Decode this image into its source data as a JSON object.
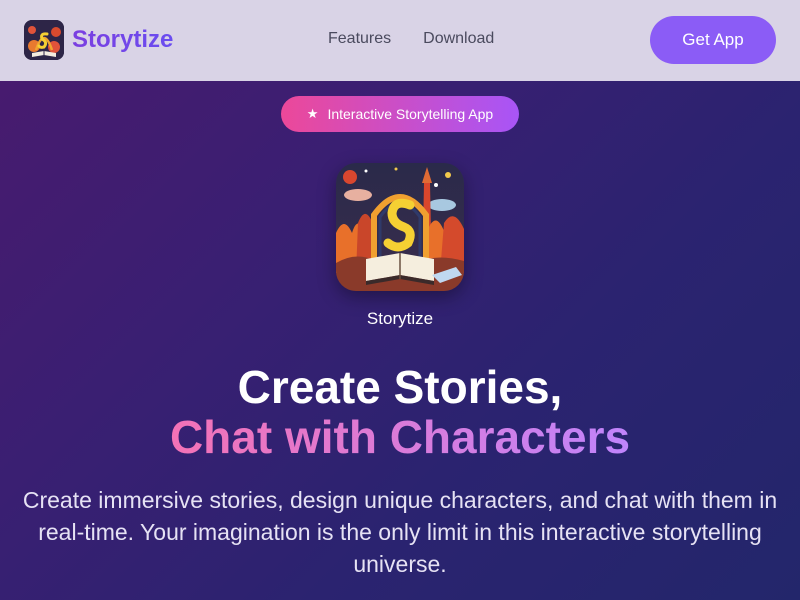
{
  "header": {
    "brand": "Storytize",
    "nav": [
      "Features",
      "Download"
    ],
    "cta_label": "Get App"
  },
  "badge": {
    "icon": "star-icon",
    "label": "Interactive Storytelling App"
  },
  "app": {
    "name": "Storytize",
    "icon": "storytize-app-icon"
  },
  "hero": {
    "headline_line1": "Create Stories,",
    "headline_line2": "Chat with Characters",
    "subtitle": "Create immersive stories, design unique characters, and chat with them in real-time. Your imagination is the only limit in this interactive storytelling universe."
  },
  "colors": {
    "accent": "#8b5cf6",
    "badge_start": "#ec4899",
    "badge_end": "#a855f7",
    "header_bg": "#d9d3e6"
  }
}
